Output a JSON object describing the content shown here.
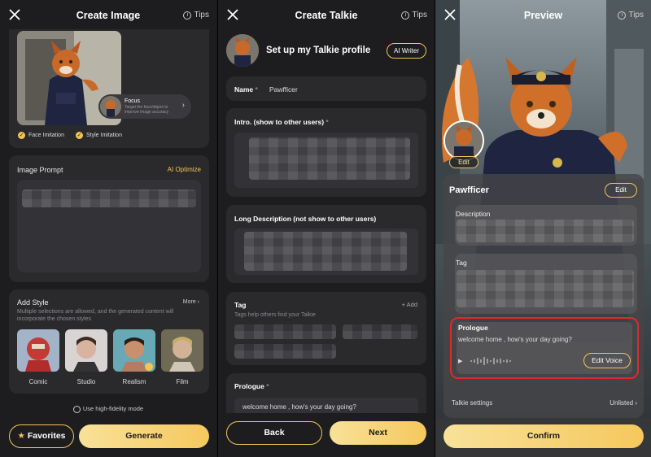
{
  "panel1": {
    "title": "Create Image",
    "tips": "Tips",
    "focus": {
      "title": "Focus",
      "desc": "Target the face/object to improve image accuracy"
    },
    "face_imitation": "Face Imitation",
    "style_imitation": "Style Imitation",
    "image_prompt_label": "Image Prompt",
    "ai_optimize": "AI Optimize",
    "add_style_label": "Add Style",
    "more": "More",
    "add_style_desc": "Multiple selections are allowed, and the generated content will incorporate the chosen styles",
    "styles": [
      "Comic",
      "Studio",
      "Realism",
      "Film"
    ],
    "high_fidelity": "Use high-fidelity mode",
    "favorites": "Favorites",
    "generate": "Generate"
  },
  "panel2": {
    "title": "Create Talkie",
    "tips": "Tips",
    "profile_heading": "Set up my Talkie profile",
    "ai_writer": "AI Writer",
    "name_label": "Name",
    "name_value": "Pawfficer",
    "intro_label": "Intro. (show to other users)",
    "long_desc_label": "Long Description (not show to other users)",
    "tag_label": "Tag",
    "tag_add": "Add",
    "tag_desc": "Tags help others find your Talkie",
    "prologue_label": "Prologue",
    "prologue_value": "welcome home , how's your day going?",
    "back": "Back",
    "next": "Next",
    "required_mark": "*"
  },
  "panel3": {
    "title": "Preview",
    "tips": "Tips",
    "avatar_edit": "Edit",
    "name": "Pawfficer",
    "name_edit": "Edit",
    "description_label": "Description",
    "tag_label": "Tag",
    "prologue_label": "Prologue",
    "prologue_value": "welcome home , how's your day going?",
    "edit_voice": "Edit Voice",
    "talkie_settings": "Talkie settings",
    "unlisted": "Unlisted",
    "confirm": "Confirm"
  },
  "colors": {
    "accent": "#f3c453",
    "highlight": "#e0282b",
    "panel_bg": "#1d1d20",
    "card_bg": "#2a2a2d"
  }
}
